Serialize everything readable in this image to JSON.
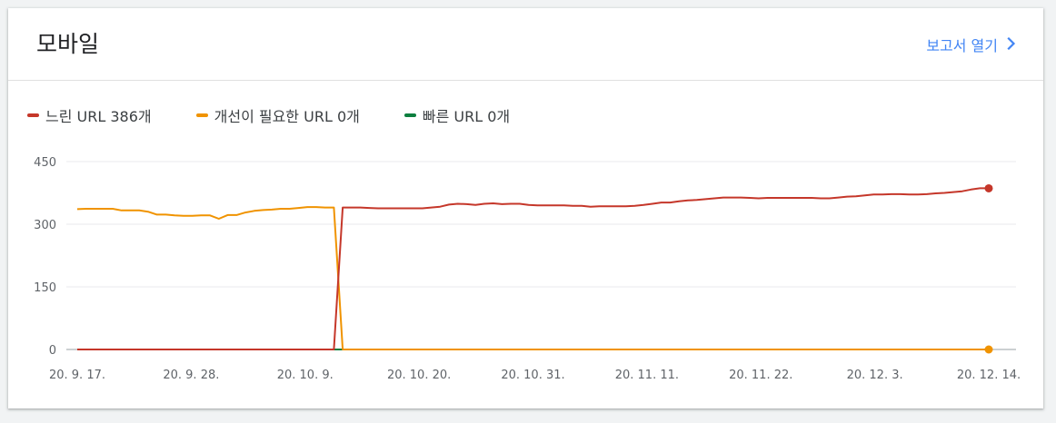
{
  "header": {
    "title": "모바일",
    "report_link_label": "보고서 열기"
  },
  "legend": [
    {
      "label": "느린 URL 386개",
      "color": "#c5372a"
    },
    {
      "label": "개선이 필요한 URL 0개",
      "color": "#f09300"
    },
    {
      "label": "빠른 URL 0개",
      "color": "#0d7f3f"
    }
  ],
  "chart_data": {
    "type": "line",
    "x_ticks": [
      "20. 9. 17.",
      "20. 9. 28.",
      "20. 10. 9.",
      "20. 10. 20.",
      "20. 10. 31.",
      "20. 11. 11.",
      "20. 11. 22.",
      "20. 12. 3.",
      "20. 12. 14."
    ],
    "y_ticks": [
      "450",
      "300",
      "150",
      "0"
    ],
    "ylim": [
      0,
      450
    ],
    "x_start": "2020-09-17",
    "x_end": "2020-12-14",
    "grid": true,
    "series": [
      {
        "name": "느린 URL",
        "color": "#c5372a",
        "values": [
          0,
          0,
          0,
          0,
          0,
          0,
          0,
          0,
          0,
          0,
          0,
          0,
          0,
          0,
          0,
          0,
          0,
          0,
          0,
          0,
          0,
          0,
          0,
          0,
          0,
          0,
          0,
          0,
          0,
          0,
          340,
          340,
          340,
          339,
          338,
          338,
          338,
          338,
          338,
          338,
          340,
          342,
          347,
          349,
          348,
          346,
          349,
          350,
          348,
          349,
          349,
          346,
          345,
          345,
          345,
          345,
          344,
          344,
          342,
          343,
          343,
          343,
          343,
          344,
          346,
          349,
          352,
          352,
          355,
          357,
          358,
          360,
          362,
          364,
          364,
          364,
          363,
          362,
          363,
          363,
          363,
          363,
          363,
          363,
          362,
          362,
          364,
          366,
          367,
          369,
          371,
          371,
          372,
          372,
          371,
          371,
          372,
          374,
          375,
          377,
          379,
          383,
          386,
          386
        ],
        "end_marker": true
      },
      {
        "name": "개선이 필요한 URL",
        "color": "#f09300",
        "values": [
          336,
          337,
          337,
          337,
          337,
          333,
          333,
          333,
          330,
          323,
          323,
          321,
          320,
          320,
          321,
          321,
          313,
          322,
          322,
          328,
          332,
          334,
          335,
          337,
          337,
          339,
          341,
          341,
          340,
          340,
          0,
          0,
          0,
          0,
          0,
          0,
          0,
          0,
          0,
          0,
          0,
          0,
          0,
          0,
          0,
          0,
          0,
          0,
          0,
          0,
          0,
          0,
          0,
          0,
          0,
          0,
          0,
          0,
          0,
          0,
          0,
          0,
          0,
          0,
          0,
          0,
          0,
          0,
          0,
          0,
          0,
          0,
          0,
          0,
          0,
          0,
          0,
          0,
          0,
          0,
          0,
          0,
          0,
          0,
          0,
          0,
          0,
          0,
          0,
          0,
          0,
          0,
          0,
          0,
          0,
          0,
          0,
          0,
          0,
          0,
          0,
          0,
          0,
          0
        ],
        "end_marker": true
      },
      {
        "name": "빠른 URL",
        "color": "#0d7f3f",
        "values": [
          0,
          0,
          0,
          0,
          0,
          0,
          0,
          0,
          0,
          0,
          0,
          0,
          0,
          0,
          0,
          0,
          0,
          0,
          0,
          0,
          0,
          0,
          0,
          0,
          0,
          0,
          0,
          0,
          0,
          0,
          0,
          0,
          0,
          0,
          0,
          0,
          0,
          0,
          0,
          0,
          0,
          0,
          0,
          0,
          0,
          0,
          0,
          0,
          0,
          0,
          0,
          0,
          0,
          0,
          0,
          0,
          0,
          0,
          0,
          0,
          0,
          0,
          0,
          0,
          0,
          0,
          0,
          0,
          0,
          0,
          0,
          0,
          0,
          0,
          0,
          0,
          0,
          0,
          0,
          0,
          0,
          0,
          0,
          0,
          0,
          0,
          0,
          0,
          0,
          0,
          0,
          0,
          0,
          0,
          0,
          0,
          0,
          0,
          0,
          0,
          0,
          0,
          0,
          0
        ],
        "end_marker": false
      }
    ]
  }
}
